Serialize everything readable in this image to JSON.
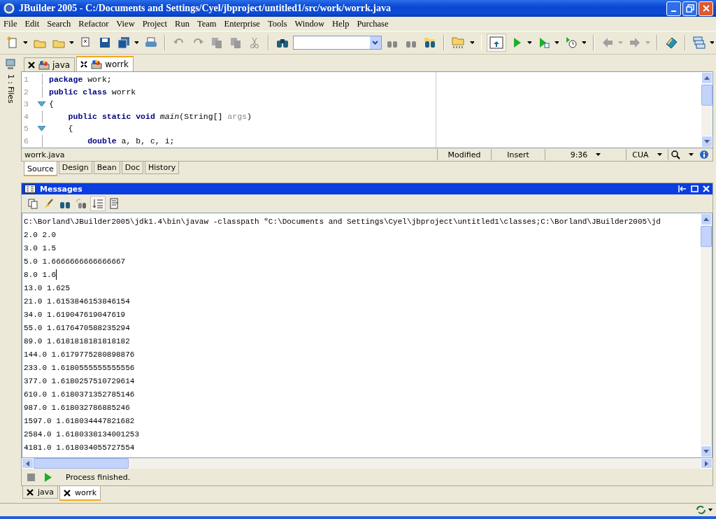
{
  "window": {
    "title": "JBuilder 2005 - C:/Documents and Settings/Cyel/jbproject/untitled1/src/work/worrk.java"
  },
  "menu": [
    "File",
    "Edit",
    "Search",
    "Refactor",
    "View",
    "Project",
    "Run",
    "Team",
    "Enterprise",
    "Tools",
    "Window",
    "Help",
    "Purchase"
  ],
  "side_strip": {
    "label": "1 : Files"
  },
  "editor_tabs": [
    {
      "label": "java",
      "selected": false
    },
    {
      "label": "worrk",
      "selected": true
    }
  ],
  "code": [
    {
      "number": "1",
      "fold": false,
      "tokens": [
        {
          "text": "package",
          "kind": "keyword"
        },
        {
          "text": " work;",
          "kind": "plain"
        }
      ]
    },
    {
      "number": "2",
      "fold": false,
      "tokens": [
        {
          "text": "public class",
          "kind": "keyword"
        },
        {
          "text": " worrk",
          "kind": "plain"
        }
      ]
    },
    {
      "number": "3",
      "fold": true,
      "tokens": [
        {
          "text": "{",
          "kind": "plain"
        }
      ]
    },
    {
      "number": "4",
      "fold": false,
      "tokens": [
        {
          "text": "    public static void ",
          "kind": "keyword"
        },
        {
          "text": "main",
          "kind": "method"
        },
        {
          "text": "(String[] ",
          "kind": "plain"
        },
        {
          "text": "args",
          "kind": "param"
        },
        {
          "text": ")",
          "kind": "plain"
        }
      ]
    },
    {
      "number": "5",
      "fold": true,
      "tokens": [
        {
          "text": "    {",
          "kind": "plain"
        }
      ]
    },
    {
      "number": "6",
      "fold": false,
      "tokens": [
        {
          "text": "        double",
          "kind": "keyword"
        },
        {
          "text": " a, b, c, i;",
          "kind": "plain"
        }
      ]
    }
  ],
  "editor_status": {
    "file": "worrk.java",
    "modified": "Modified",
    "mode": "Insert",
    "position": "9:36",
    "keymap": "CUA"
  },
  "view_tabs": [
    {
      "label": "Source",
      "selected": true
    },
    {
      "label": "Design",
      "selected": false
    },
    {
      "label": "Bean",
      "selected": false
    },
    {
      "label": "Doc",
      "selected": false
    },
    {
      "label": "History",
      "selected": false
    }
  ],
  "messages": {
    "title": "Messages",
    "lines": [
      {
        "text": "C:\\Borland\\JBuilder2005\\jdk1.4\\bin\\javaw -classpath \"C:\\Documents and Settings\\Cyel\\jbproject\\untitled1\\classes;C:\\Borland\\JBuilder2005\\jd",
        "cursor": false
      },
      {
        "text": "2.0 2.0",
        "cursor": false
      },
      {
        "text": "3.0 1.5",
        "cursor": false
      },
      {
        "text": "5.0 1.6666666666666667",
        "cursor": false
      },
      {
        "text": "8.0 1.6",
        "cursor": true
      },
      {
        "text": "13.0 1.625",
        "cursor": false
      },
      {
        "text": "21.0 1.6153846153846154",
        "cursor": false
      },
      {
        "text": "34.0 1.619047619047619",
        "cursor": false
      },
      {
        "text": "55.0 1.6176470588235294",
        "cursor": false
      },
      {
        "text": "89.0 1.6181818181818182",
        "cursor": false
      },
      {
        "text": "144.0 1.6179775280898876",
        "cursor": false
      },
      {
        "text": "233.0 1.6180555555555556",
        "cursor": false
      },
      {
        "text": "377.0 1.6180257510729614",
        "cursor": false
      },
      {
        "text": "610.0 1.6180371352785146",
        "cursor": false
      },
      {
        "text": "987.0 1.618032786885246",
        "cursor": false
      },
      {
        "text": "1597.0 1.618034447821682",
        "cursor": false
      },
      {
        "text": "2584.0 1.6180338134001253",
        "cursor": false
      },
      {
        "text": "4181.0 1.618034055727554",
        "cursor": false
      }
    ],
    "status": "Process finished."
  },
  "bottom_tabs": [
    {
      "label": "java",
      "selected": false
    },
    {
      "label": "worrk",
      "selected": true
    }
  ]
}
